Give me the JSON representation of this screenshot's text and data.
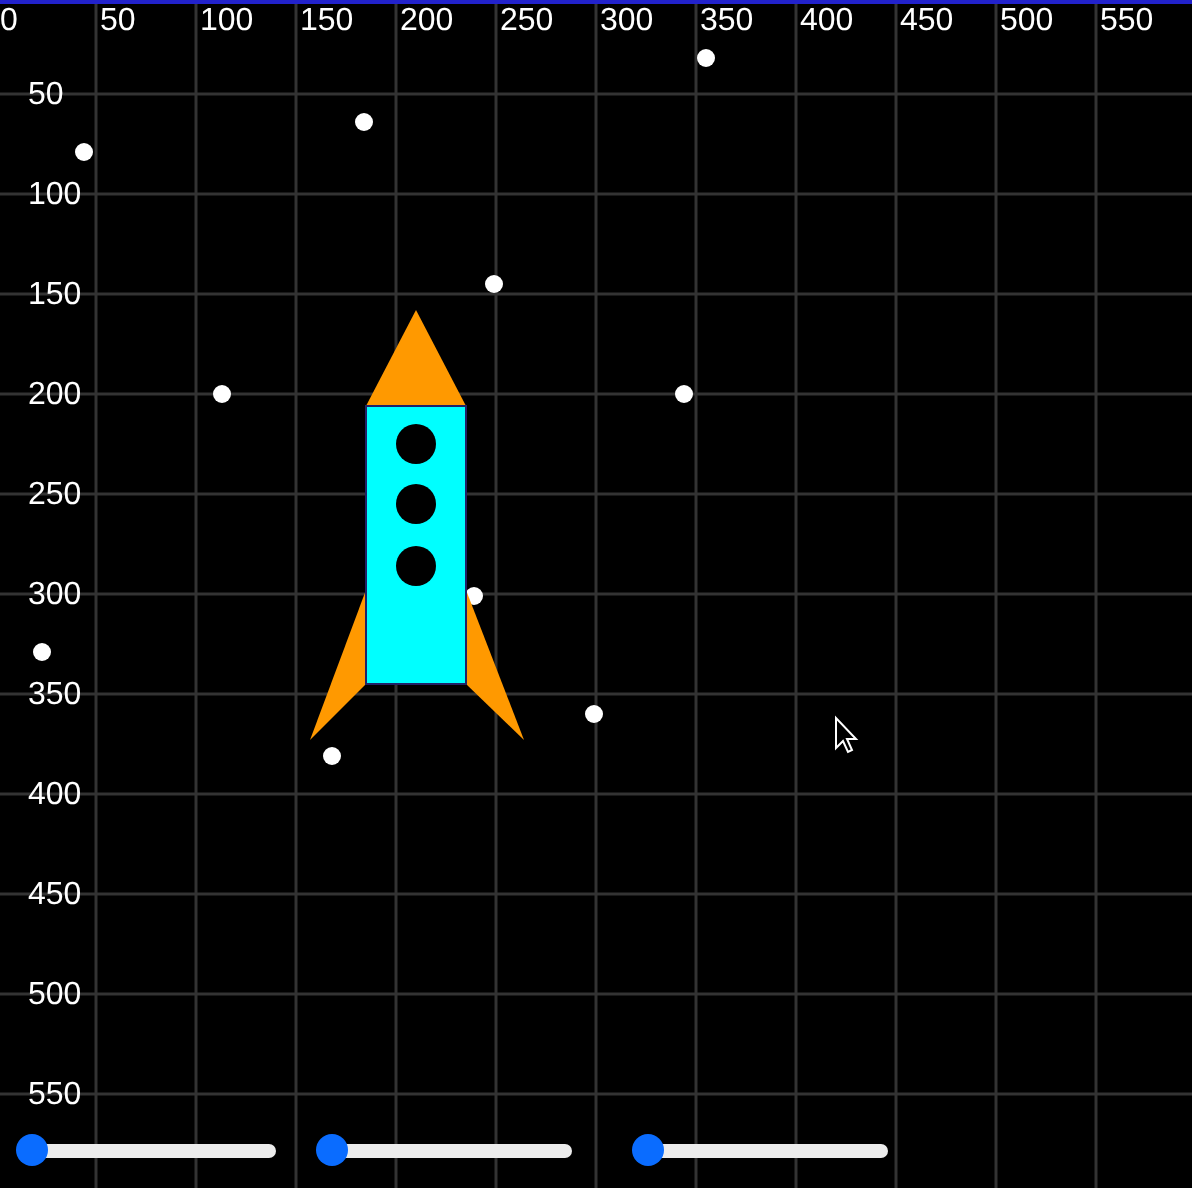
{
  "x_axis": {
    "labels": [
      "0",
      "50",
      "100",
      "150",
      "200",
      "250",
      "300",
      "350",
      "400",
      "450",
      "500",
      "550"
    ]
  },
  "y_axis": {
    "labels": [
      "50",
      "100",
      "150",
      "200",
      "250",
      "300",
      "350",
      "400",
      "450",
      "500",
      "550"
    ]
  },
  "sliders": [
    {
      "level": 0
    },
    {
      "level": 0
    },
    {
      "level": 0
    }
  ]
}
